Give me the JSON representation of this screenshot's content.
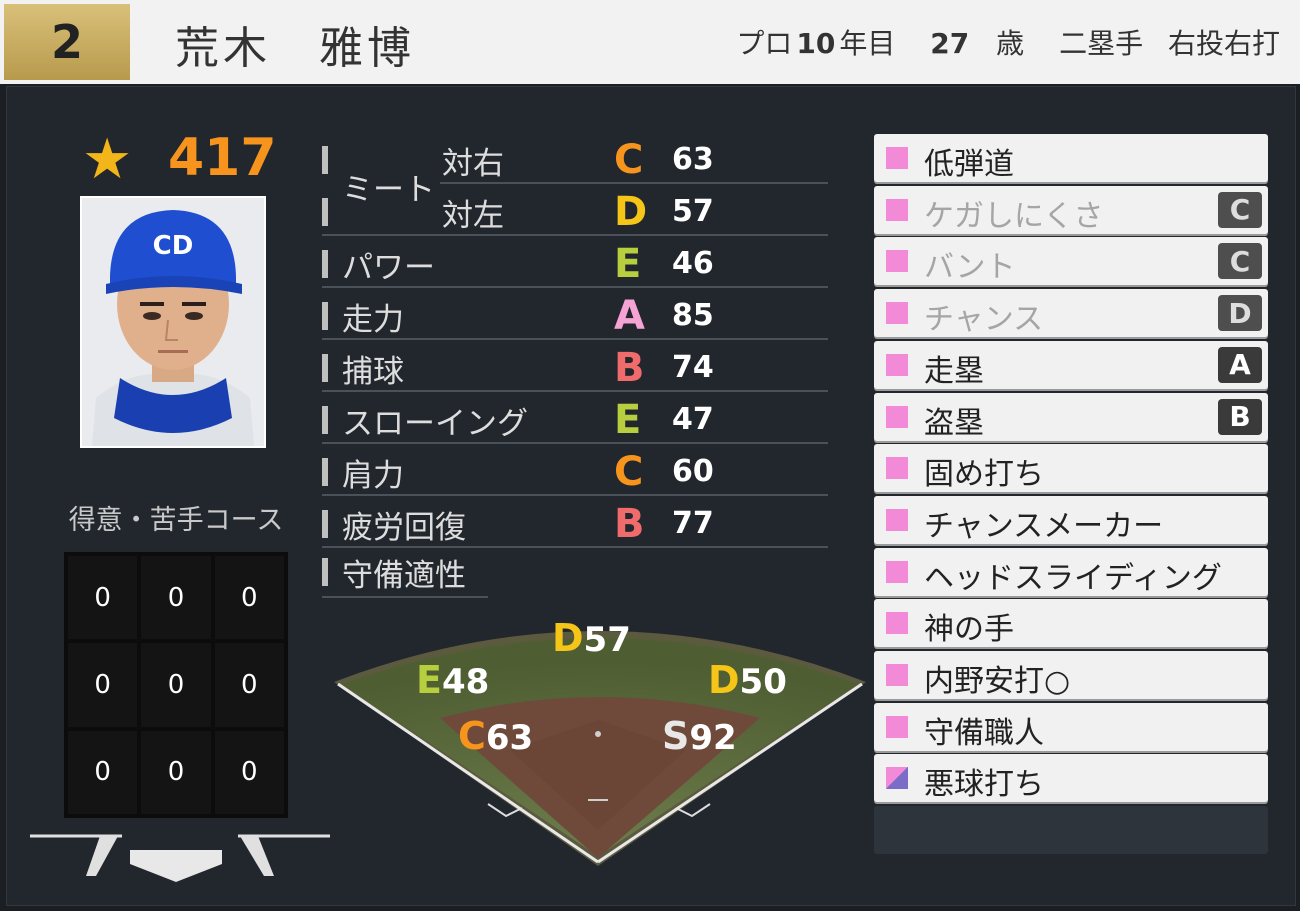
{
  "header": {
    "number": "2",
    "name": "荒木　雅博",
    "pro_year_prefix": "プロ",
    "pro_year_value": "10",
    "pro_year_suffix": "年目",
    "age_value": "27",
    "age_unit": "歳",
    "position": "二塁手",
    "handedness": "右投右打"
  },
  "rating": {
    "icon": "star-icon",
    "value": "417",
    "color": "#f7941d"
  },
  "course": {
    "title": "得意・苦手コース",
    "cells": [
      "0",
      "0",
      "0",
      "0",
      "0",
      "0",
      "0",
      "0",
      "0"
    ]
  },
  "stats": {
    "meet_label": "ミート",
    "meet_right_label": "対右",
    "meet_right_grade": "C",
    "meet_right_value": "63",
    "meet_left_label": "対左",
    "meet_left_grade": "D",
    "meet_left_value": "57",
    "rows": [
      {
        "label": "パワー",
        "grade": "E",
        "value": "46"
      },
      {
        "label": "走力",
        "grade": "A",
        "value": "85"
      },
      {
        "label": "捕球",
        "grade": "B",
        "value": "74"
      },
      {
        "label": "スローイング",
        "grade": "E",
        "value": "47"
      },
      {
        "label": "肩力",
        "grade": "C",
        "value": "60"
      },
      {
        "label": "疲労回復",
        "grade": "B",
        "value": "77"
      }
    ],
    "defense_label": "守備適性"
  },
  "grade_colors": {
    "S": "#e8e8e8",
    "A": "#f5a3d4",
    "B": "#f06b6b",
    "C": "#f7941d",
    "D": "#f5c518",
    "E": "#b7cf3f"
  },
  "field": {
    "center": {
      "grade": "D",
      "value": "57"
    },
    "left": {
      "grade": "E",
      "value": "48"
    },
    "right": {
      "grade": "D",
      "value": "50"
    },
    "third": {
      "grade": "C",
      "value": "63"
    },
    "first": {
      "grade": "S",
      "value": "92"
    }
  },
  "abilities": [
    {
      "label": "低弾道",
      "rank": "",
      "dim": false
    },
    {
      "label": "ケガしにくさ",
      "rank": "C",
      "dim": true
    },
    {
      "label": "バント",
      "rank": "C",
      "dim": true
    },
    {
      "label": "チャンス",
      "rank": "D",
      "dim": true
    },
    {
      "label": "走塁",
      "rank": "A",
      "dim": false
    },
    {
      "label": "盗塁",
      "rank": "B",
      "dim": false
    },
    {
      "label": "固め打ち",
      "rank": "",
      "dim": false
    },
    {
      "label": "チャンスメーカー",
      "rank": "",
      "dim": false
    },
    {
      "label": "ヘッドスライディング",
      "rank": "",
      "dim": false
    },
    {
      "label": "神の手",
      "rank": "",
      "dim": false
    },
    {
      "label": "内野安打○",
      "rank": "",
      "dim": false
    },
    {
      "label": "守備職人",
      "rank": "",
      "dim": false
    },
    {
      "label": "悪球打ち",
      "rank": "",
      "dim": false,
      "split": true
    }
  ]
}
